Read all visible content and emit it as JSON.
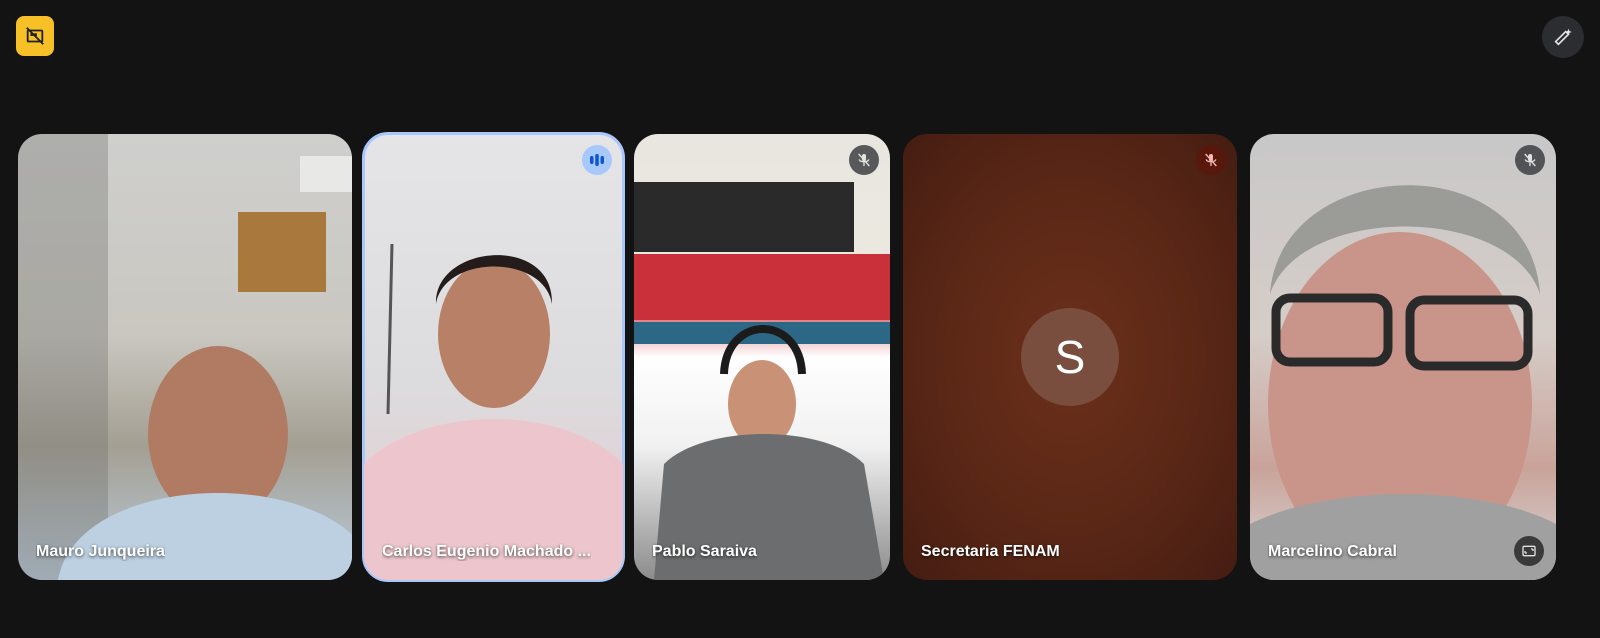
{
  "participants": [
    {
      "name": "Mauro Junqueira",
      "status": "video"
    },
    {
      "name": "Carlos Eugenio Machado ...",
      "status": "speaking"
    },
    {
      "name": "Pablo Saraiva",
      "status": "muted"
    },
    {
      "name": "Secretaria FENAM",
      "status": "muted",
      "avatar_letter": "S"
    },
    {
      "name": "Marcelino Cabral",
      "status": "muted"
    }
  ],
  "colors": {
    "background": "#131314",
    "accent_yellow": "#f6c026",
    "speaking_outline": "#a8c7fa"
  }
}
